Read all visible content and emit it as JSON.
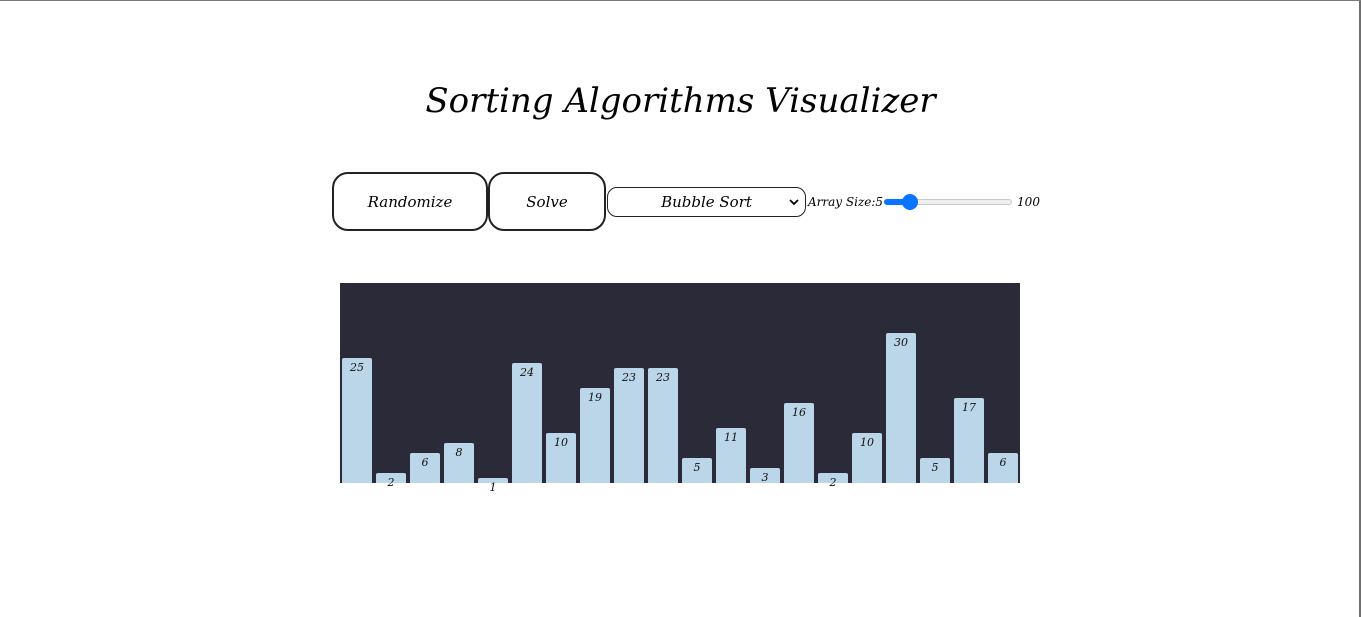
{
  "title": "Sorting Algorithms Visualizer",
  "controls": {
    "randomize_label": "Randomize",
    "solve_label": "Solve",
    "algorithm_selected": "Bubble Sort",
    "array_size_label": "Array Size:5",
    "array_size_max_label": "100",
    "array_size_value": 20,
    "array_size_min": 5,
    "array_size_max": 100
  },
  "icons": {
    "select": "chevron-down-icon"
  },
  "colors": {
    "chart_background": "#2b2a38",
    "bar": "#bad6e8",
    "slider_accent": "#0a75ff"
  },
  "chart_data": {
    "type": "bar",
    "values": [
      25,
      2,
      6,
      8,
      1,
      24,
      10,
      19,
      23,
      23,
      5,
      11,
      3,
      16,
      2,
      10,
      30,
      5,
      17,
      6
    ]
  }
}
